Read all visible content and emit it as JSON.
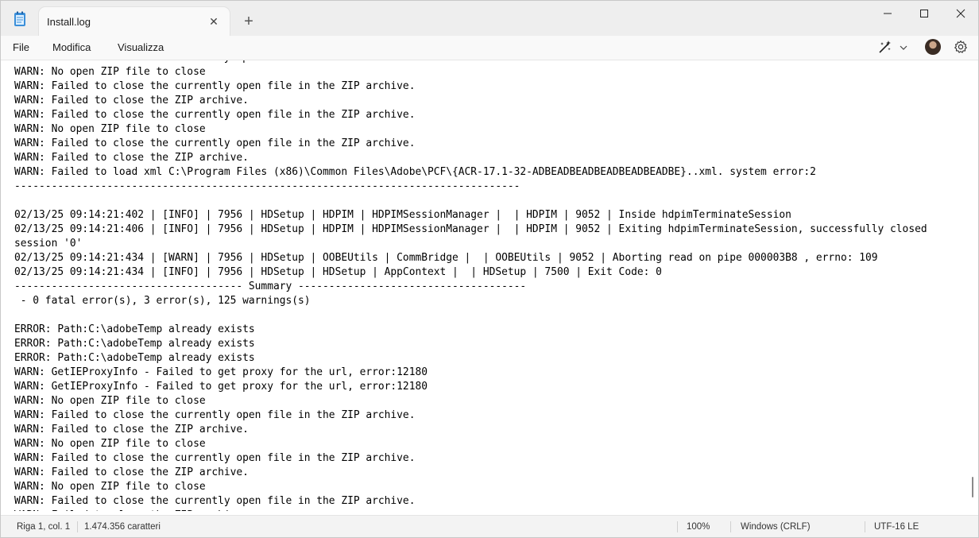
{
  "window": {
    "tab_title": "Install.log",
    "new_tab_symbol": "+",
    "close_tab_symbol": "✕"
  },
  "menu": {
    "items": [
      "File",
      "Modifica",
      "Visualizza"
    ]
  },
  "editor": {
    "lines": [
      "WARN: Failed to close the currently open file in the ZIP archive.",
      "WARN: No open ZIP file to close",
      "WARN: Failed to close the currently open file in the ZIP archive.",
      "WARN: Failed to close the ZIP archive.",
      "WARN: Failed to close the currently open file in the ZIP archive.",
      "WARN: No open ZIP file to close",
      "WARN: Failed to close the currently open file in the ZIP archive.",
      "WARN: Failed to close the ZIP archive.",
      "WARN: Failed to load xml C:\\Program Files (x86)\\Common Files\\Adobe\\PCF\\{ACR-17.1-32-ADBEADBEADBEADBEADBEADBE}..xml. system error:2",
      "----------------------------------------------------------------------------------",
      "",
      "02/13/25 09:14:21:402 | [INFO] | 7956 | HDSetup | HDPIM | HDPIMSessionManager |  | HDPIM | 9052 | Inside hdpimTerminateSession",
      "02/13/25 09:14:21:406 | [INFO] | 7956 | HDSetup | HDPIM | HDPIMSessionManager |  | HDPIM | 9052 | Exiting hdpimTerminateSession, successfully closed",
      "session '0'",
      "02/13/25 09:14:21:434 | [WARN] | 7956 | HDSetup | OOBEUtils | CommBridge |  | OOBEUtils | 9052 | Aborting read on pipe 000003B8 , errno: 109",
      "02/13/25 09:14:21:434 | [INFO] | 7956 | HDSetup | HDSetup | AppContext |  | HDSetup | 7500 | Exit Code: 0",
      "------------------------------------- Summary -------------------------------------",
      " - 0 fatal error(s), 3 error(s), 125 warnings(s)",
      "",
      "ERROR: Path:C:\\adobeTemp already exists",
      "ERROR: Path:C:\\adobeTemp already exists",
      "ERROR: Path:C:\\adobeTemp already exists",
      "WARN: GetIEProxyInfo - Failed to get proxy for the url, error:12180",
      "WARN: GetIEProxyInfo - Failed to get proxy for the url, error:12180",
      "WARN: No open ZIP file to close",
      "WARN: Failed to close the currently open file in the ZIP archive.",
      "WARN: Failed to close the ZIP archive.",
      "WARN: No open ZIP file to close",
      "WARN: Failed to close the currently open file in the ZIP archive.",
      "WARN: Failed to close the ZIP archive.",
      "WARN: No open ZIP file to close",
      "WARN: Failed to close the currently open file in the ZIP archive.",
      "WARN: Failed to close the ZIP archive."
    ]
  },
  "status": {
    "position": "Riga 1, col. 1",
    "char_count": "1.474.356 caratteri",
    "zoom": "100%",
    "line_ending": "Windows (CRLF)",
    "encoding": "UTF-16 LE"
  },
  "colors": {
    "titlebar_bg": "#eeeeee",
    "tab_bg": "#f9f9f9",
    "statusbar_bg": "#f3f3f3",
    "app_icon_blue": "#3b8fd9"
  },
  "icons": [
    "notepad-icon",
    "close-icon",
    "plus-icon",
    "minimize-icon",
    "maximize-icon",
    "copilot-icon",
    "chevron-down-icon",
    "avatar",
    "gear-icon"
  ]
}
